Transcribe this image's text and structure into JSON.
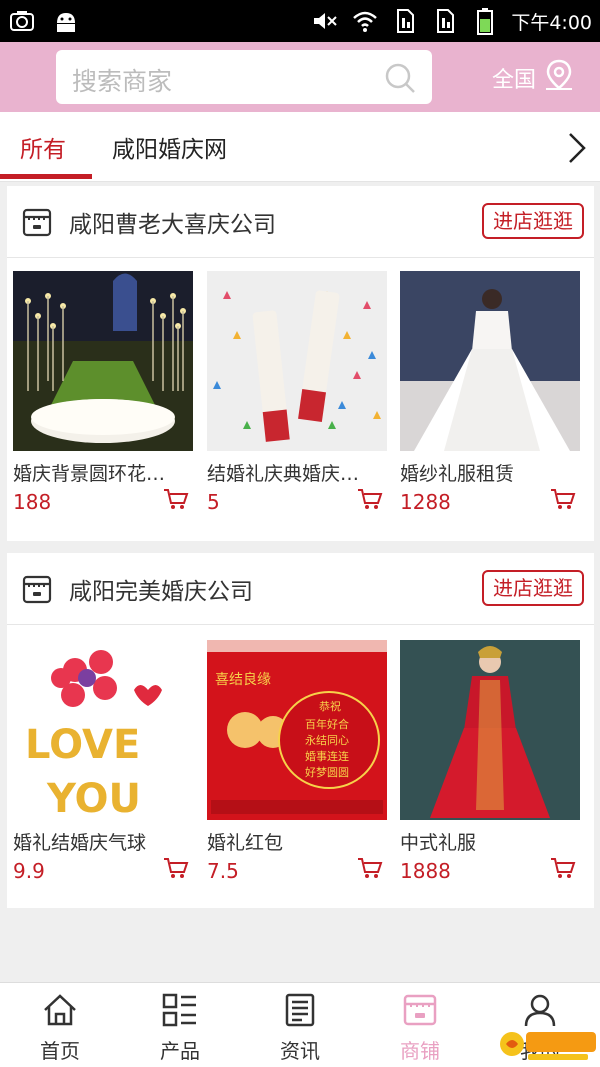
{
  "status_bar": {
    "time": "下午4:00",
    "icons": [
      "screenshot-icon",
      "android-icon",
      "mute-icon",
      "wifi-icon",
      "sim1-icon",
      "sim2-icon",
      "battery-icon"
    ]
  },
  "search": {
    "placeholder": "搜索商家",
    "region_label": "全国"
  },
  "tabs": [
    {
      "label": "所有",
      "active": true
    },
    {
      "label": "咸阳婚庆网",
      "active": false
    }
  ],
  "stores": [
    {
      "name": "咸阳曹老大喜庆公司",
      "enter_label": "进店逛逛",
      "products": [
        {
          "title": "婚庆背景圆环花…",
          "price": "188",
          "image": "wedding-stage-photo"
        },
        {
          "title": "结婚礼庆典婚庆…",
          "price": "5",
          "image": "confetti-cannon-photo"
        },
        {
          "title": "婚纱礼服租赁",
          "price": "1288",
          "image": "wedding-dress-photo"
        }
      ]
    },
    {
      "name": "咸阳完美婚庆公司",
      "enter_label": "进店逛逛",
      "products": [
        {
          "title": "婚礼结婚庆气球",
          "price": "9.9",
          "image": "love-you-balloons-photo",
          "image_text": [
            "LOVE",
            "YOU"
          ]
        },
        {
          "title": "婚礼红包",
          "price": "7.5",
          "image": "red-envelope-photo",
          "image_text": [
            "喜结良缘",
            "恭祝",
            "百年好合",
            "永结同心",
            "婚事连连",
            "好梦圆圆"
          ]
        },
        {
          "title": "中式礼服",
          "price": "1888",
          "image": "chinese-dress-photo"
        }
      ]
    }
  ],
  "bottom_nav": [
    {
      "label": "首页",
      "icon": "home-icon",
      "active": false
    },
    {
      "label": "产品",
      "icon": "grid-list-icon",
      "active": false
    },
    {
      "label": "资讯",
      "icon": "news-icon",
      "active": false
    },
    {
      "label": "商铺",
      "icon": "shop-icon",
      "active": true
    },
    {
      "label": "我的",
      "icon": "user-icon",
      "active": false
    }
  ],
  "colors": {
    "accent": "#c41e26",
    "header_pink": "#e9b3cf",
    "active_nav_pink": "#e9a0c2"
  }
}
